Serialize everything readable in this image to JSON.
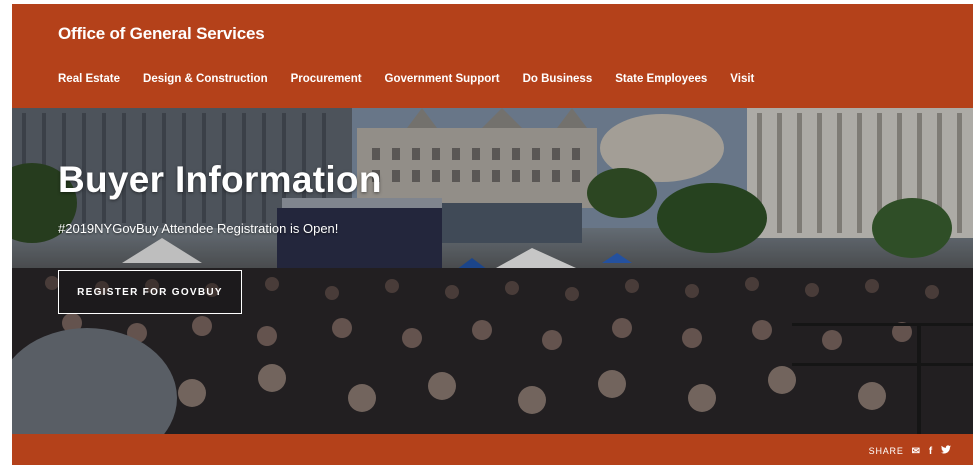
{
  "header": {
    "site_title": "Office of General Services",
    "nav": [
      "Real Estate",
      "Design & Construction",
      "Procurement",
      "Government Support",
      "Do Business",
      "State Employees",
      "Visit"
    ]
  },
  "hero": {
    "title": "Buyer Information",
    "subtitle": "#2019NYGovBuy Attendee Registration is Open!",
    "button_label": "REGISTER FOR GOVBUY"
  },
  "footer": {
    "share_label": "SHARE",
    "icons": [
      "email-icon",
      "facebook-icon",
      "twitter-icon"
    ],
    "email_glyph": "✉",
    "facebook_glyph": "f",
    "twitter_glyph": "🐦"
  },
  "colors": {
    "brand": "#b4411a"
  }
}
